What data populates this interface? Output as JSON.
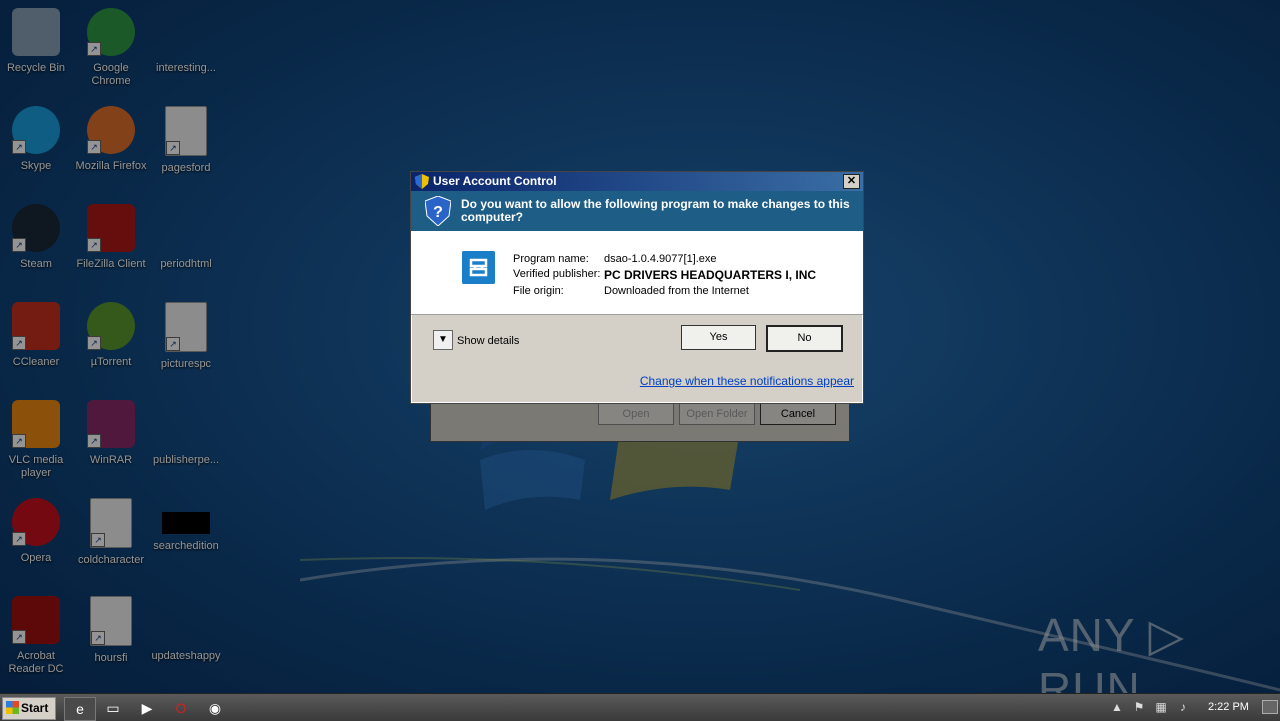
{
  "desktop": {
    "icons": [
      {
        "label": "Recycle Bin",
        "icon": "recycle-bin-icon"
      },
      {
        "label": "Google Chrome",
        "icon": "chrome-icon"
      },
      {
        "label": "interesting...",
        "icon": "folder-icon"
      },
      {
        "label": "Skype",
        "icon": "skype-icon"
      },
      {
        "label": "Mozilla Firefox",
        "icon": "firefox-icon"
      },
      {
        "label": "pagesford",
        "icon": "word-document-icon"
      },
      {
        "label": "Steam",
        "icon": "steam-icon"
      },
      {
        "label": "FileZilla Client",
        "icon": "filezilla-icon"
      },
      {
        "label": "periodhtml",
        "icon": "file-icon"
      },
      {
        "label": "CCleaner",
        "icon": "ccleaner-icon"
      },
      {
        "label": "µTorrent",
        "icon": "utorrent-icon"
      },
      {
        "label": "picturespc",
        "icon": "word-document-icon"
      },
      {
        "label": "VLC media player",
        "icon": "vlc-icon"
      },
      {
        "label": "WinRAR",
        "icon": "winrar-icon"
      },
      {
        "label": "publisherpe...",
        "icon": "file-icon"
      },
      {
        "label": "Opera",
        "icon": "opera-icon"
      },
      {
        "label": "coldcharacter",
        "icon": "word-document-icon"
      },
      {
        "label": "searchedition",
        "icon": "black-file-icon"
      },
      {
        "label": "Acrobat Reader DC",
        "icon": "acrobat-icon"
      },
      {
        "label": "hoursfi",
        "icon": "word-document-icon"
      },
      {
        "label": "updateshappy",
        "icon": "file-icon"
      }
    ]
  },
  "background_dialog": {
    "open_label": "Open",
    "open_folder_label": "Open Folder",
    "cancel_label": "Cancel"
  },
  "uac": {
    "title": "User Account Control",
    "question": "Do you want to allow the following program to make changes to this computer?",
    "program_name_label": "Program name:",
    "program_name_value": "dsao-1.0.4.9077[1].exe",
    "publisher_label": "Verified publisher:",
    "publisher_value": "PC DRIVERS HEADQUARTERS I, INC",
    "origin_label": "File origin:",
    "origin_value": "Downloaded from the Internet",
    "show_details_label": "Show details",
    "yes_label": "Yes",
    "no_label": "No",
    "change_link": "Change when these notifications appear"
  },
  "watermark": "ANY ▷ RUN",
  "taskbar": {
    "start_label": "Start",
    "clock": "2:22 PM"
  },
  "colors": {
    "uac_header": "#1e5d86",
    "link": "#0040c0"
  }
}
